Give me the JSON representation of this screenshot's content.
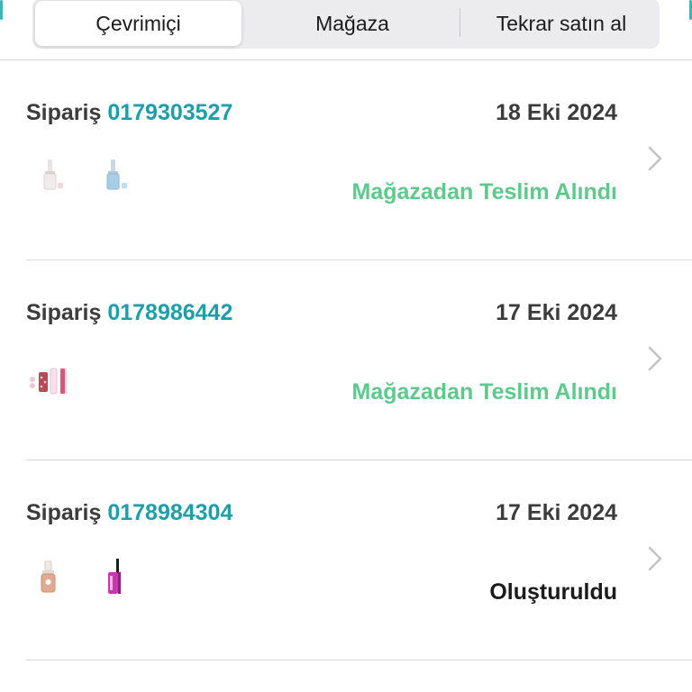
{
  "tabs": [
    {
      "label": "Çevrimiçi",
      "active": true
    },
    {
      "label": "Mağaza",
      "active": false
    },
    {
      "label": "Tekrar satın al",
      "active": false
    }
  ],
  "colors": {
    "accent": "#1e9ea8",
    "delivered": "#5ec98d",
    "created": "#1b1b1b",
    "text": "#3c3c3c"
  },
  "orders": [
    {
      "prefix": "Sipariş",
      "number": "0179303527",
      "date": "18 Eki 2024",
      "status": "Mağazadan Teslim Alındı",
      "status_kind": "delivered",
      "products": [
        "nail-polish-nude-icon",
        "nail-polish-light-blue-icon"
      ]
    },
    {
      "prefix": "Sipariş",
      "number": "0178986442",
      "date": "17 Eki 2024",
      "status": "Mağazadan Teslim Alındı",
      "status_kind": "delivered",
      "products": [
        "lip-gloss-set-icon"
      ]
    },
    {
      "prefix": "Sipariş",
      "number": "0178984304",
      "date": "17 Eki 2024",
      "status": "Oluşturuldu",
      "status_kind": "created",
      "products": [
        "nail-polish-peach-icon",
        "mascara-pink-icon"
      ]
    }
  ]
}
